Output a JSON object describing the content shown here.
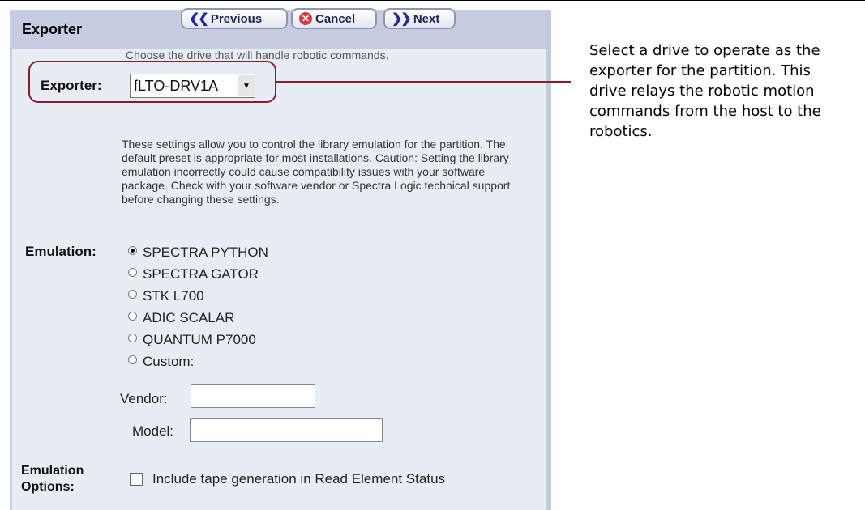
{
  "panel": {
    "title": "Exporter",
    "buttons": {
      "previous": "Previous",
      "cancel": "Cancel",
      "next": "Next"
    }
  },
  "exporter": {
    "hint": "Choose the drive that will handle robotic commands.",
    "label": "Exporter:",
    "selected": "fLTO-DRV1A"
  },
  "emulation": {
    "description": "These settings allow you to control the library emulation for the partition. The default preset is appropriate for most installations. Caution: Setting the library emulation incorrectly could cause compatibility issues with your software package. Check with your software vendor or Spectra Logic technical support before changing these settings.",
    "label": "Emulation:",
    "options": [
      {
        "label": "SPECTRA PYTHON",
        "selected": true
      },
      {
        "label": "SPECTRA GATOR",
        "selected": false
      },
      {
        "label": "STK L700",
        "selected": false
      },
      {
        "label": "ADIC SCALAR",
        "selected": false
      },
      {
        "label": "QUANTUM P7000",
        "selected": false
      },
      {
        "label": "Custom:",
        "selected": false
      }
    ],
    "vendor_label": "Vendor:",
    "vendor_value": "",
    "model_label": "Model:",
    "model_value": ""
  },
  "emulation_options": {
    "label_line1": "Emulation",
    "label_line2": "Options:",
    "checkbox_label": "Include tape generation in Read Element Status",
    "checked": false
  },
  "callout": {
    "text": "Select a drive to operate as the exporter for the partition. This drive relays the robotic motion commands from the host to the robotics."
  },
  "colors": {
    "callout_line": "#8b1c2a",
    "header": "#c6cde3",
    "panel": "#e8ecf5"
  }
}
